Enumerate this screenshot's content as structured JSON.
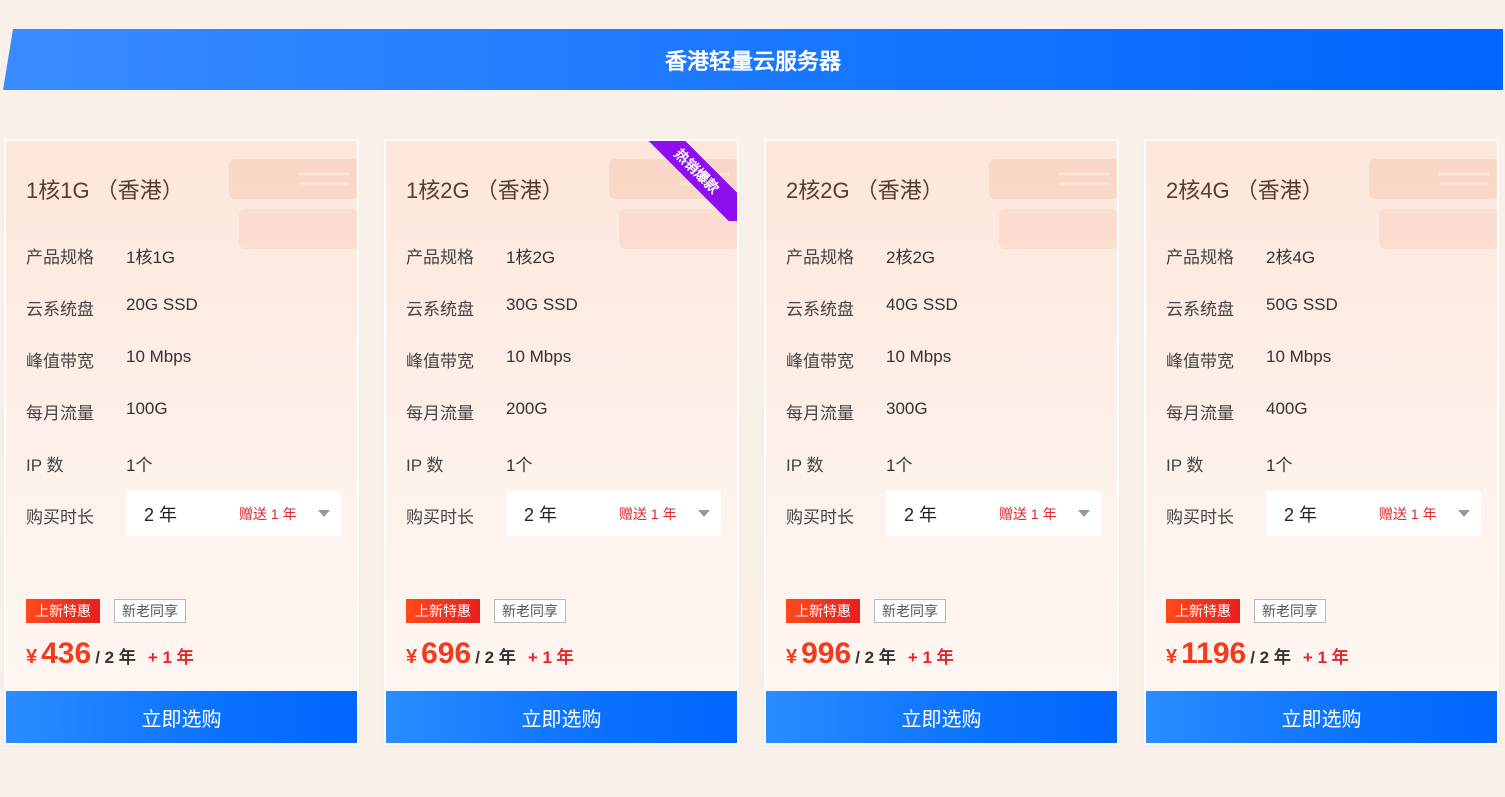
{
  "banner": {
    "title": "香港轻量云服务器"
  },
  "labels": {
    "spec": "产品规格",
    "disk": "云系统盘",
    "bandwidth": "峰值带宽",
    "traffic": "每月流量",
    "ip": "IP 数",
    "duration": "购买时长",
    "tag_hot": "上新特惠",
    "tag_share": "新老同享",
    "currency": "¥",
    "buy": "立即选购"
  },
  "ribbon": "热销爆款",
  "cards": [
    {
      "title": "1核1G （香港）",
      "spec": "1核1G",
      "disk": "20G SSD",
      "bandwidth": "10 Mbps",
      "traffic": "100G",
      "ip": "1个",
      "duration": "2 年",
      "gift": "赠送 1 年",
      "price": "436",
      "per": "/ 2 年",
      "bonus": "+ 1 年"
    },
    {
      "title": "1核2G （香港）",
      "spec": "1核2G",
      "disk": "30G SSD",
      "bandwidth": "10 Mbps",
      "traffic": "200G",
      "ip": "1个",
      "duration": "2 年",
      "gift": "赠送 1 年",
      "price": "696",
      "per": "/ 2 年",
      "bonus": "+ 1 年"
    },
    {
      "title": "2核2G （香港）",
      "spec": "2核2G",
      "disk": "40G SSD",
      "bandwidth": "10 Mbps",
      "traffic": "300G",
      "ip": "1个",
      "duration": "2 年",
      "gift": "赠送 1 年",
      "price": "996",
      "per": "/ 2 年",
      "bonus": "+ 1 年"
    },
    {
      "title": "2核4G （香港）",
      "spec": "2核4G",
      "disk": "50G SSD",
      "bandwidth": "10 Mbps",
      "traffic": "400G",
      "ip": "1个",
      "duration": "2 年",
      "gift": "赠送 1 年",
      "price": "1196",
      "per": "/ 2 年",
      "bonus": "+ 1 年"
    }
  ],
  "colors": {
    "accent_blue": "#0066ff",
    "price_red": "#f23a1e",
    "ribbon_purple": "#8e0ef0"
  }
}
